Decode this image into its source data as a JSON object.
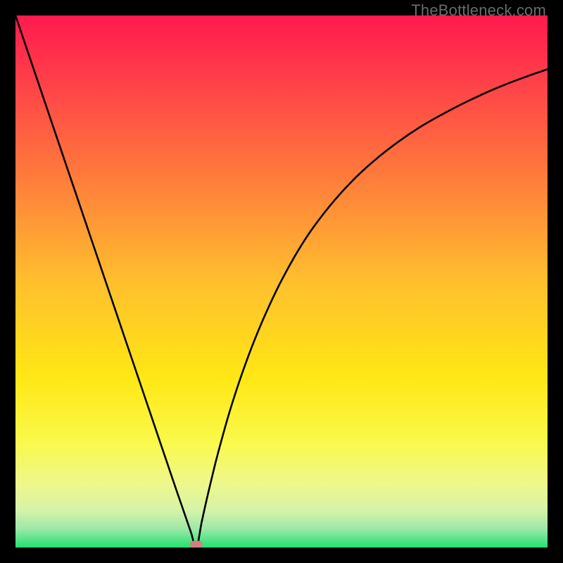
{
  "watermark": "TheBottleneck.com",
  "chart_data": {
    "type": "line",
    "title": "",
    "xlabel": "",
    "ylabel": "",
    "xlim": [
      0,
      100
    ],
    "ylim": [
      0,
      100
    ],
    "grid": false,
    "curve_description": "V-shaped bottleneck curve: steep drop from top-left to a minimum around x≈34, then rises with decreasing slope toward upper right.",
    "minimum_x": 34.0,
    "minimum_y": 0.0,
    "marker": {
      "x": 34.0,
      "y": 0.6,
      "color": "#d08080",
      "shape": "pill"
    },
    "background": {
      "type": "vertical-gradient",
      "stops": [
        {
          "pos": 0.0,
          "color": "#ff1a4d"
        },
        {
          "pos": 0.12,
          "color": "#ff3f49"
        },
        {
          "pos": 0.3,
          "color": "#ff7a3c"
        },
        {
          "pos": 0.5,
          "color": "#ffbf2e"
        },
        {
          "pos": 0.68,
          "color": "#ffe714"
        },
        {
          "pos": 0.8,
          "color": "#faf94a"
        },
        {
          "pos": 0.88,
          "color": "#eef88b"
        },
        {
          "pos": 0.93,
          "color": "#d5f3a8"
        },
        {
          "pos": 0.965,
          "color": "#9de8a8"
        },
        {
          "pos": 1.0,
          "color": "#23e171"
        }
      ]
    },
    "series": [
      {
        "name": "bottleneck-curve",
        "x": [
          0,
          2,
          4,
          6,
          8,
          10,
          12,
          14,
          16,
          18,
          20,
          22,
          24,
          26,
          28,
          30,
          31,
          32,
          33,
          34,
          35,
          36,
          37,
          38,
          40,
          42,
          44,
          46,
          48,
          50,
          53,
          56,
          60,
          64,
          68,
          72,
          76,
          80,
          84,
          88,
          92,
          96,
          100
        ],
        "y": [
          100,
          94.1,
          88.2,
          82.3,
          76.4,
          70.5,
          64.6,
          58.7,
          52.8,
          46.9,
          41.0,
          35.1,
          29.2,
          23.3,
          17.4,
          11.5,
          8.6,
          5.7,
          2.8,
          0.0,
          4.8,
          9.3,
          13.5,
          17.5,
          24.7,
          31.0,
          36.6,
          41.6,
          46.1,
          50.2,
          55.6,
          60.2,
          65.3,
          69.6,
          73.2,
          76.3,
          79.0,
          81.3,
          83.4,
          85.3,
          87.0,
          88.5,
          89.9
        ]
      }
    ]
  }
}
